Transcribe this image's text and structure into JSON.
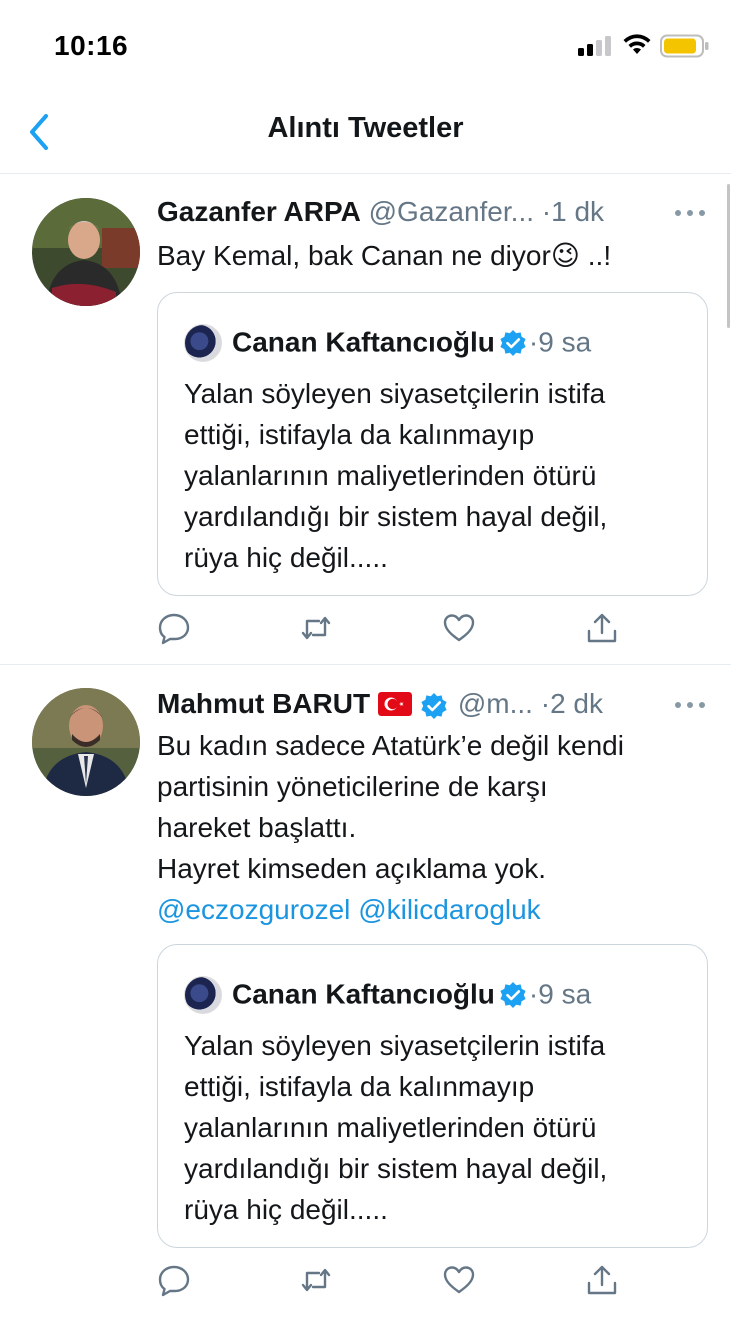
{
  "status_bar": {
    "time": "10:16"
  },
  "nav": {
    "title": "Alıntı Tweetler"
  },
  "tweets": [
    {
      "name": "Gazanfer ARPA",
      "handle": "@Gazanfer...",
      "time": "1 dk",
      "text_lines": [
        "Bay Kemal, bak Canan ne diyor",
        " ..!"
      ],
      "emoji": "😉",
      "quote": {
        "name": "Canan Kaftancıoğlu",
        "time": "9 sa",
        "text_lines": [
          "Yalan söyleyen siyasetçilerin istifa",
          "ettiği, istifayla da kalınmayıp",
          "yalanlarının maliyetlerinden ötürü",
          "yardılandığı bir sistem hayal değil,",
          "rüya hiç değil....."
        ]
      }
    },
    {
      "name": "Mahmut BARUT",
      "handle": "@m...",
      "time": "2 dk",
      "text_lines": [
        "Bu kadın sadece Atatürk’e değil kendi",
        "partisinin yöneticilerine de karşı",
        "hareket başlattı.",
        "Hayret kimseden açıklama yok."
      ],
      "mentions": [
        "@eczozgurozel",
        "@kilicdarogluk"
      ],
      "quote": {
        "name": "Canan Kaftancıoğlu",
        "time": "9 sa",
        "text_lines": [
          "Yalan söyleyen siyasetçilerin istifa",
          "ettiği, istifayla da kalınmayıp",
          "yalanlarının maliyetlerinden ötürü",
          "yardılandığı bir sistem hayal değil,",
          "rüya hiç değil....."
        ]
      }
    }
  ],
  "colors": {
    "accent": "#1da1f2",
    "text": "#14171a",
    "muted": "#657786",
    "border": "#e6ecf0"
  },
  "icons": [
    "back-chevron-icon",
    "reply-icon",
    "retweet-icon",
    "like-icon",
    "share-icon",
    "verified-badge-icon",
    "more-icon",
    "turkey-flag-icon"
  ]
}
